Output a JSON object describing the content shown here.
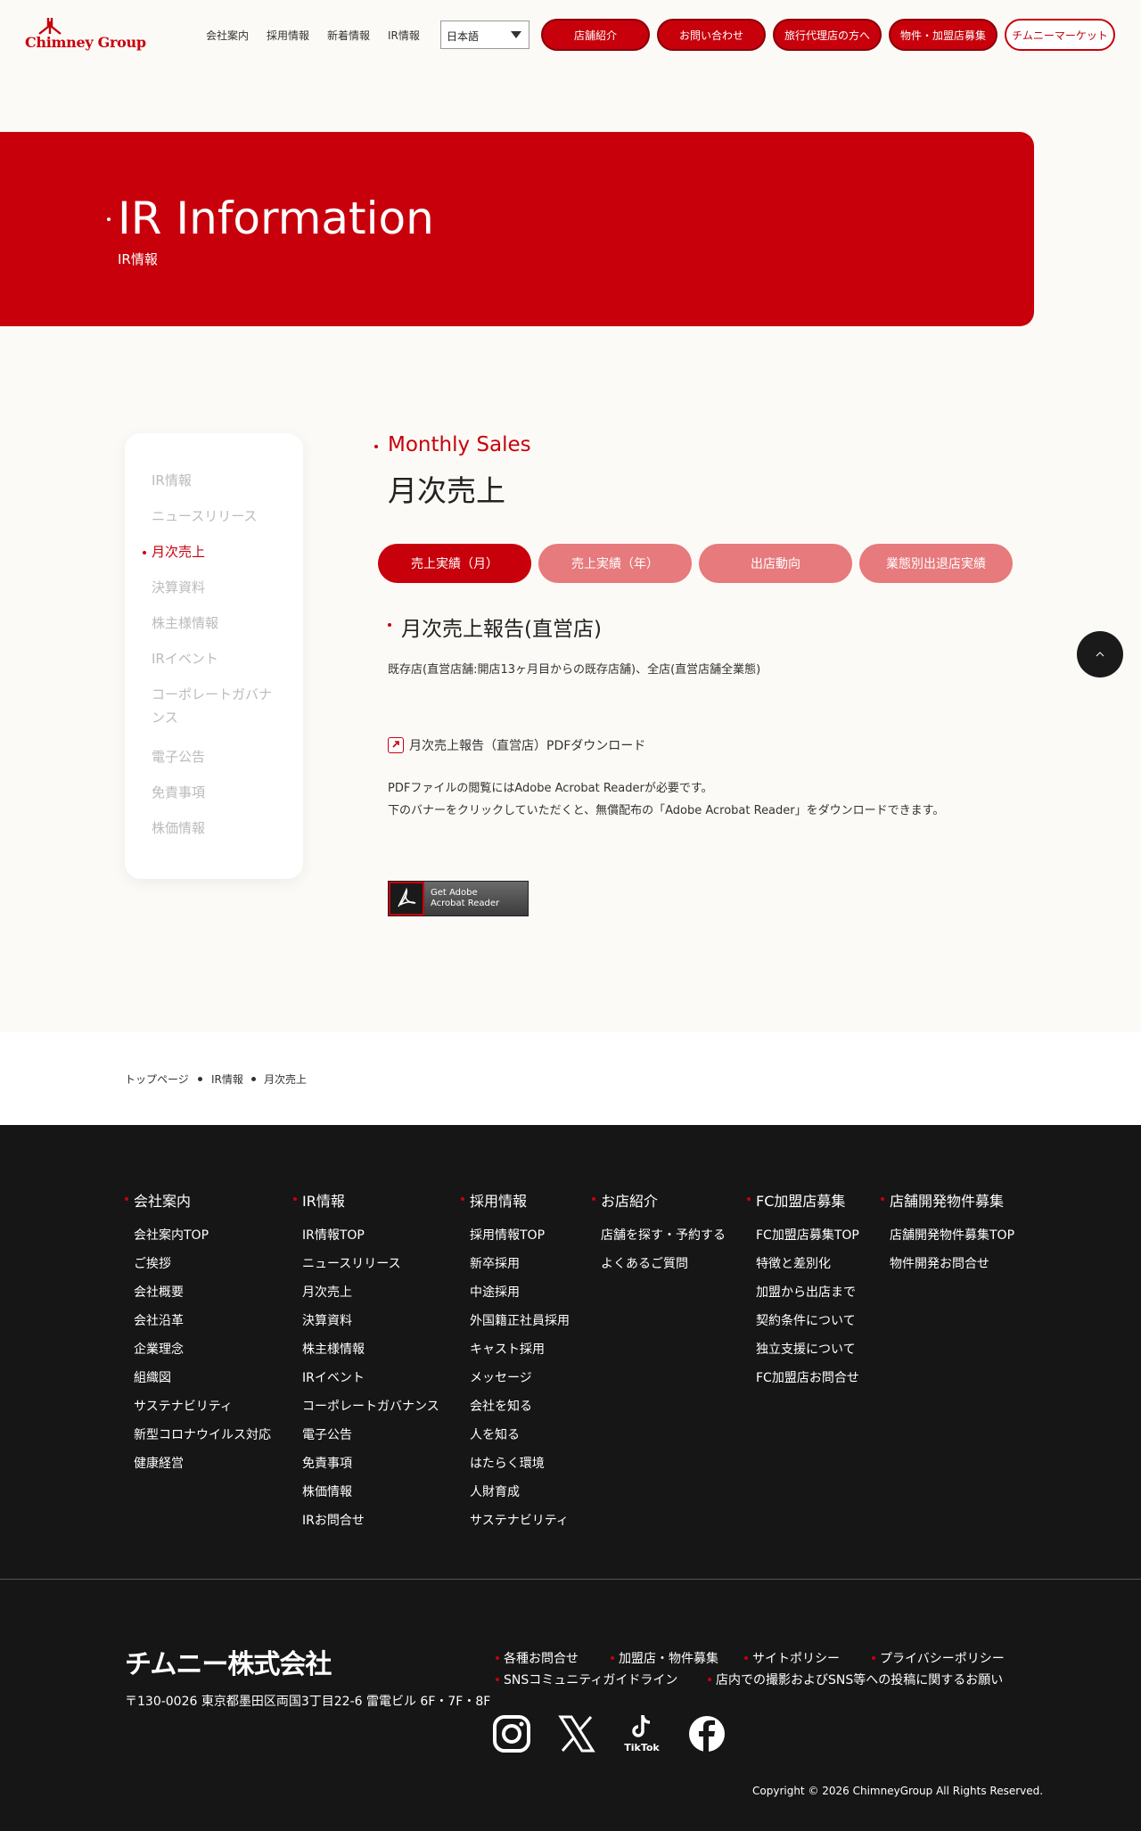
{
  "header": {
    "logo_text": "Chimney Group",
    "nav": [
      "会社案内",
      "採用情報",
      "新着情報",
      "IR情報"
    ],
    "language": "日本語",
    "buttons": [
      "店舗紹介",
      "お問い合わせ",
      "旅行代理店の方へ",
      "物件・加盟店募集"
    ],
    "market_button": "チムニーマーケット"
  },
  "hero": {
    "title": "IR Information",
    "subtitle": "IR情報"
  },
  "sidebar": {
    "items": [
      {
        "label": "IR情報"
      },
      {
        "label": "ニュースリリース"
      },
      {
        "label": "月次売上"
      },
      {
        "label": "決算資料"
      },
      {
        "label": "株主様情報"
      },
      {
        "label": "IRイベント"
      },
      {
        "label": "コーポレートガバナンス"
      },
      {
        "label": "電子公告"
      },
      {
        "label": "免責事項"
      },
      {
        "label": "株価情報"
      }
    ],
    "active": "月次売上"
  },
  "main": {
    "section_en": "Monthly Sales",
    "section_ja": "月次売上",
    "tabs": [
      "売上実績（月）",
      "売上実績（年）",
      "出店動向",
      "業態別出退店実績"
    ],
    "heading": "月次売上報告(直営店)",
    "description": "既存店(直営店舗:開店13ヶ月目からの既存店舗)、全店(直営店舗全業態)",
    "pdf_link": "月次売上報告（直営店）PDFダウンロード",
    "note_line1": "PDFファイルの閲覧にはAdobe Acrobat Readerが必要です。",
    "note_line2": "下のバナーをクリックしていただくと、無償配布の「Adobe Acrobat Reader」をダウンロードできます。",
    "adobe_line1": "Get Adobe",
    "adobe_line2": "Acrobat Reader"
  },
  "breadcrumb": [
    "トップページ",
    "IR情報",
    "月次売上"
  ],
  "footer": {
    "columns": [
      {
        "title": "会社案内",
        "links": [
          "会社案内TOP",
          "ご挨拶",
          "会社概要",
          "会社沿革",
          "企業理念",
          "組織図",
          "サステナビリティ",
          "新型コロナウイルス対応",
          "健康経営"
        ]
      },
      {
        "title": "IR情報",
        "links": [
          "IR情報TOP",
          "ニュースリリース",
          "月次売上",
          "決算資料",
          "株主様情報",
          "IRイベント",
          "コーポレートガバナンス",
          "電子公告",
          "免責事項",
          "株価情報",
          "IRお問合せ"
        ]
      },
      {
        "title": "採用情報",
        "links": [
          "採用情報TOP",
          "新卒採用",
          "中途採用",
          "外国籍正社員採用",
          "キャスト採用",
          "メッセージ",
          "会社を知る",
          "人を知る",
          "はたらく環境",
          "人財育成",
          "サステナビリティ"
        ]
      },
      {
        "title": "お店紹介",
        "links": [
          "店舗を探す・予約する",
          "よくあるご質問"
        ]
      },
      {
        "title": "FC加盟店募集",
        "links": [
          "FC加盟店募集TOP",
          "特徴と差別化",
          "加盟から出店まで",
          "契約条件について",
          "独立支援について",
          "FC加盟店お問合せ"
        ]
      },
      {
        "title": "店舗開発物件募集",
        "links": [
          "店舗開発物件募集TOP",
          "物件開発お問合せ"
        ]
      }
    ],
    "corp_name": "チムニー株式会社",
    "address": "〒130-0026 東京都墨田区両国3丁目22-6 雷電ビル 6F・7F・8F",
    "policy_links": [
      "各種お問合せ",
      "加盟店・物件募集",
      "サイトポリシー",
      "プライバシーポリシー",
      "SNSコミュニティガイドライン",
      "店内での撮影およびSNS等への投稿に関するお願い"
    ],
    "social": [
      {
        "icon": "instagram-icon"
      },
      {
        "icon": "x-icon"
      },
      {
        "icon": "tiktok-icon",
        "label": "TikTok"
      },
      {
        "icon": "facebook-icon"
      }
    ],
    "copyright": "Copyright © 2026 ChimneyGroup All Rights Reserved."
  },
  "colors": {
    "brand": "#c8000b",
    "tab_inactive": "#e77a7c",
    "footer_bg": "#161616",
    "page_bg": "#fcfaf6"
  }
}
